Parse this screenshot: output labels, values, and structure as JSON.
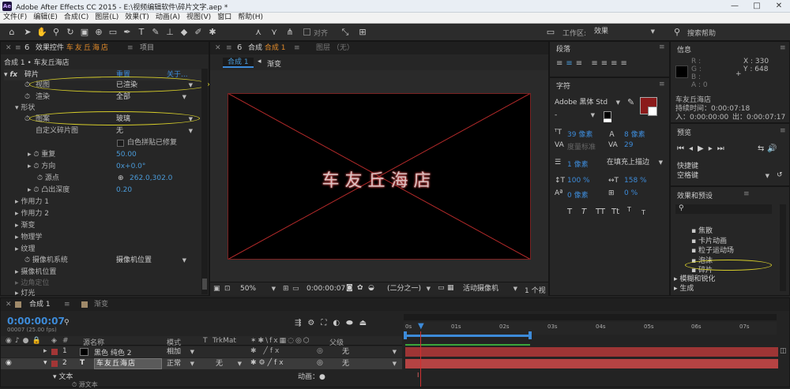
{
  "window": {
    "app_icon": "Ae",
    "title": "Adobe After Effects CC 2015 - E:\\视频编辑软件\\碎片文字.aep *",
    "min": "—",
    "max": "□",
    "close": "✕"
  },
  "menu": [
    "文件(F)",
    "编辑(E)",
    "合成(C)",
    "图层(L)",
    "效果(T)",
    "动画(A)",
    "视图(V)",
    "窗口",
    "帮助(H)"
  ],
  "toolbar": {
    "align_label": "对齐",
    "workspace_label": "工作区:",
    "workspace_value": "效果",
    "search_help": "搜索帮助"
  },
  "effect_controls": {
    "tab_label": "效果控件",
    "layer_name": "车友丘海店",
    "tab_project": "项目",
    "breadcrumb": "合成 1 • 车友丘海店",
    "effect_name": "碎片",
    "reset": "重置",
    "about": "关于...",
    "view_label": "视图",
    "view_value": "已渲染",
    "render_label": "渲染",
    "render_value": "全部",
    "shape_label": "形状",
    "pattern_label": "图案",
    "pattern_value": "玻璃",
    "custom_label": "自定义碎片图",
    "custom_value": "无",
    "white_tiles": "白色拼贴已修复",
    "repeat_label": "重复",
    "repeat_value": "50.00",
    "direction_label": "方向",
    "direction_value": "0x+0.0°",
    "source_label": "源点",
    "source_value": "262.0,302.0",
    "depth_label": "凸出深度",
    "depth_value": "0.20",
    "force1": "作用力 1",
    "force2": "作用力 2",
    "gradient": "渐变",
    "physics": "物理学",
    "texture": "纹理",
    "camera_system": "摄像机系统",
    "camera_system_value": "摄像机位置",
    "camera_position": "摄像机位置",
    "corner_pin": "边角定位",
    "light": "灯光"
  },
  "composition": {
    "tab_label": "合成",
    "tab_name": "合成 1",
    "layer_tab": "图层 （无）",
    "sub_tab": "合成 1",
    "sub_tab2": "渐变",
    "display_text": "车友丘海店",
    "zoom": "50%",
    "time": "0:00:00:07",
    "resolution": "(二分之一)",
    "camera": "活动摄像机",
    "views": "1 个视"
  },
  "paragraph": {
    "title": "段落"
  },
  "character": {
    "title": "字符",
    "font": "Adobe 黑体 Std",
    "style": "-",
    "size": "39 像素",
    "leading": "8 像素",
    "kerning": "度量标准",
    "tracking": "29",
    "stroke_width": "1 像素",
    "stroke_type": "在填充上描边",
    "vscale": "100 %",
    "hscale": "158 %",
    "baseline": "0 像素",
    "tsume": "0 %",
    "styles": [
      "T",
      "T",
      "TT",
      "Tt",
      "T",
      "T"
    ],
    "fill_color": "#8b1a1a"
  },
  "info": {
    "title": "信息",
    "r": "R :",
    "g": "G :",
    "b": "B :",
    "a": "A : 0",
    "x": "X : 330",
    "y": "Y : 648",
    "layer": "车友丘海店",
    "duration": "持续时间：0:00:07:18",
    "in": "入：0:00:00:00",
    "out": "出：0:00:07:17"
  },
  "preview": {
    "title": "预览",
    "shortcut_label": "快捷键",
    "shortcut_value": "空格键"
  },
  "effects_presets": {
    "title": "效果和预设",
    "search_placeholder": "",
    "items": [
      "焦散",
      "卡片动画",
      "粒子运动场",
      "泡沫",
      "碎片"
    ],
    "group": "模糊和锐化",
    "group2": "生成"
  },
  "timeline": {
    "tab_label": "合成 1",
    "tab2": "渐变",
    "time": "0:00:00:07",
    "frames": "00007 (25.00 fps)",
    "col_source": "源名称",
    "col_mode": "模式",
    "col_t": "T",
    "col_trkmat": "TrkMat",
    "col_parent": "父级",
    "layers": [
      {
        "num": "1",
        "name": "黑色 纯色 2",
        "mode": "相加",
        "trkmat": "",
        "parent": "无",
        "color": "#a33636"
      },
      {
        "num": "2",
        "name": "车友丘海店",
        "mode": "正常",
        "trkmat": "无",
        "parent": "无",
        "color": "#a33636"
      }
    ],
    "sub_text": "文本",
    "sub_src": "源文本",
    "animate": "动画：",
    "ruler": [
      "0s",
      "01s",
      "02s",
      "03s",
      "04s",
      "05s",
      "06s",
      "07s"
    ],
    "playhead_fraction": 0.038
  }
}
